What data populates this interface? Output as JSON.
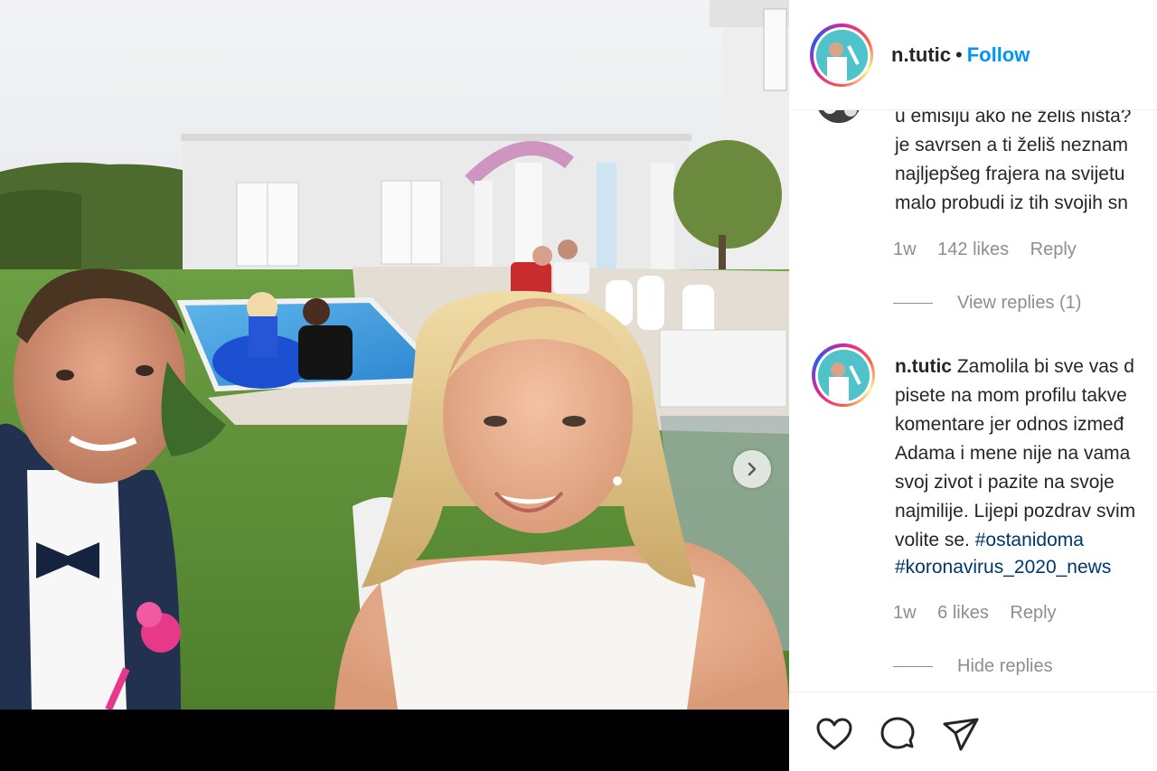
{
  "post": {
    "next_icon": "chevron-right-icon"
  },
  "header": {
    "username": "n.tutic",
    "separator": "•",
    "follow_label": "Follow"
  },
  "comments": [
    {
      "lines": [
        "u emisiju ako ne želiš ništa?",
        "je savrsen a ti želiš neznam",
        "najljepšeg frajera na svijetu",
        "malo probudi iz tih svojih sn"
      ],
      "time": "1w",
      "likes": "142 likes",
      "reply_label": "Reply",
      "view_replies": "View replies (1)"
    },
    {
      "username": "n.tutic",
      "lines": [
        "Zamolila bi sve vas d",
        "pisete na mom profilu takve",
        "komentare jer odnos izmeđ",
        "Adama i mene nije na vama",
        "svoj zivot i pazite na svoje",
        "najmilije. Lijepi pozdrav svim",
        "volite se."
      ],
      "hashtag1": "#ostanidoma",
      "hashtag2": "#koronavirus_2020_news",
      "time": "1w",
      "likes": "6 likes",
      "reply_label": "Reply",
      "hide_replies": "Hide replies"
    }
  ],
  "actions": {
    "like_icon": "heart-icon",
    "comment_icon": "comment-icon",
    "share_icon": "share-icon"
  }
}
